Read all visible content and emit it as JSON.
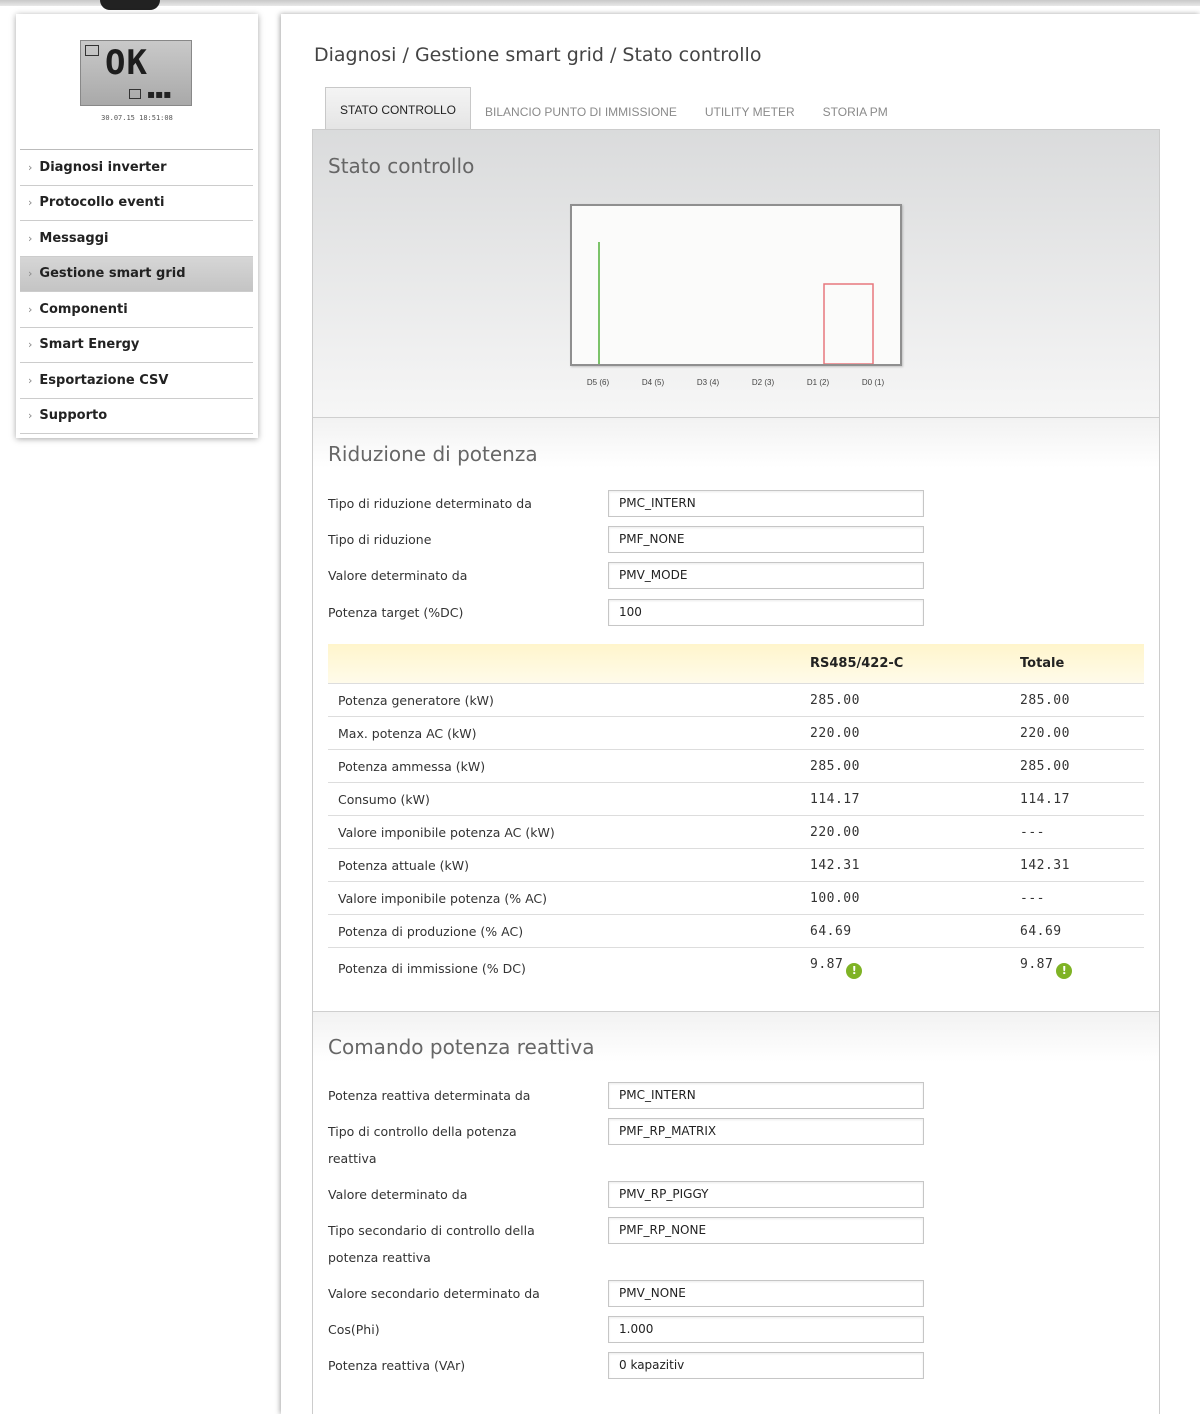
{
  "sidebar": {
    "display": {
      "status_text": "OK",
      "date": "30.07.15 18:51:08"
    },
    "items": [
      {
        "label": "Diagnosi inverter"
      },
      {
        "label": "Protocollo eventi"
      },
      {
        "label": "Messaggi"
      },
      {
        "label": "Gestione smart grid",
        "active": true
      },
      {
        "label": "Componenti"
      },
      {
        "label": "Smart Energy"
      },
      {
        "label": "Esportazione CSV"
      },
      {
        "label": "Supporto"
      }
    ]
  },
  "breadcrumb": "Diagnosi / Gestione smart grid / Stato controllo",
  "tabs": [
    {
      "label": "STATO CONTROLLO",
      "active": true
    },
    {
      "label": "BILANCIO PUNTO DI IMMISSIONE"
    },
    {
      "label": "UTILITY METER"
    },
    {
      "label": "STORIA PM"
    }
  ],
  "status_section": {
    "title": "Stato controllo",
    "chart_labels": [
      "D5 (6)",
      "D4 (5)",
      "D3 (4)",
      "D2 (3)",
      "D1 (2)",
      "D0 (1)"
    ],
    "colors": {
      "green_line": "#7cc36a",
      "red_box": "#e8777d"
    }
  },
  "reduction": {
    "title": "Riduzione di potenza",
    "fields": [
      {
        "label": "Tipo di riduzione determinato da",
        "value": "PMC_INTERN"
      },
      {
        "label": "Tipo di riduzione",
        "value": "PMF_NONE"
      },
      {
        "label": "Valore determinato da",
        "value": "PMV_MODE"
      },
      {
        "label": "Potenza target (%DC)",
        "value": "100"
      }
    ],
    "table": {
      "headers": [
        "",
        "RS485/422-C",
        "Totale"
      ],
      "rows": [
        {
          "label": "Potenza generatore (kW)",
          "c1": "285.00",
          "c2": "285.00"
        },
        {
          "label": "Max. potenza AC (kW)",
          "c1": "220.00",
          "c2": "220.00"
        },
        {
          "label": "Potenza ammessa (kW)",
          "c1": "285.00",
          "c2": "285.00"
        },
        {
          "label": "Consumo (kW)",
          "c1": "114.17",
          "c2": "114.17"
        },
        {
          "label": "Valore imponibile potenza AC (kW)",
          "c1": "220.00",
          "c2": "---"
        },
        {
          "label": "Potenza attuale (kW)",
          "c1": "142.31",
          "c2": "142.31"
        },
        {
          "label": "Valore imponibile potenza (% AC)",
          "c1": "100.00",
          "c2": "---"
        },
        {
          "label": "Potenza di produzione (% AC)",
          "c1": "64.69",
          "c2": "64.69"
        },
        {
          "label": "Potenza di immissione (% DC)",
          "c1": "9.87",
          "c2": "9.87",
          "info": "!"
        }
      ]
    }
  },
  "reactive": {
    "title": "Comando potenza reattiva",
    "fields": [
      {
        "label": "Potenza reattiva determinata da",
        "value": "PMC_INTERN"
      },
      {
        "label": "Tipo di controllo della potenza reattiva",
        "value": "PMF_RP_MATRIX"
      },
      {
        "label": "Valore determinato da",
        "value": "PMV_RP_PIGGY"
      },
      {
        "label": "Tipo secondario di controllo della potenza reattiva",
        "value": "PMF_RP_NONE"
      },
      {
        "label": "Valore secondario determinato da",
        "value": "PMV_NONE"
      },
      {
        "label": "Cos(Phi)",
        "value": "1.000"
      },
      {
        "label": "Potenza reattiva (VAr)",
        "value": "0 kapazitiv"
      }
    ]
  }
}
